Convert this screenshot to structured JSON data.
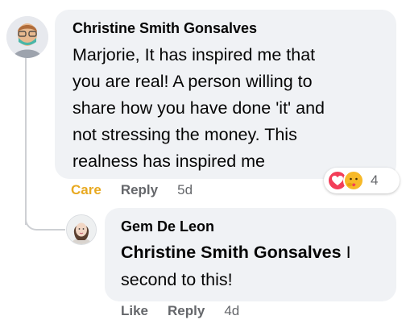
{
  "main_comment": {
    "author": "Christine Smith Gonsalves",
    "lines": [
      "Marjorie, It has inspired me that",
      "you are real! A person willing to",
      "share how you have done 'it' and",
      "not stressing the money. This",
      "realness has inspired me"
    ],
    "actions": {
      "care": "Care",
      "reply": "Reply",
      "age": "5d"
    },
    "reactions": {
      "icons": [
        "love-icon",
        "care-icon"
      ],
      "count": "4",
      "colors": {
        "love": "#f33e58",
        "care": "#f7b928"
      }
    }
  },
  "reply_comment": {
    "author": "Gem De Leon",
    "mention": "Christine Smith Gonsalves",
    "lines": [
      " I",
      "second to this!"
    ],
    "actions": {
      "like": "Like",
      "reply": "Reply",
      "age": "4d"
    }
  },
  "colors": {
    "bubble": "#f0f2f5",
    "care_accent": "#e8a920",
    "meta_text": "#65676b"
  }
}
